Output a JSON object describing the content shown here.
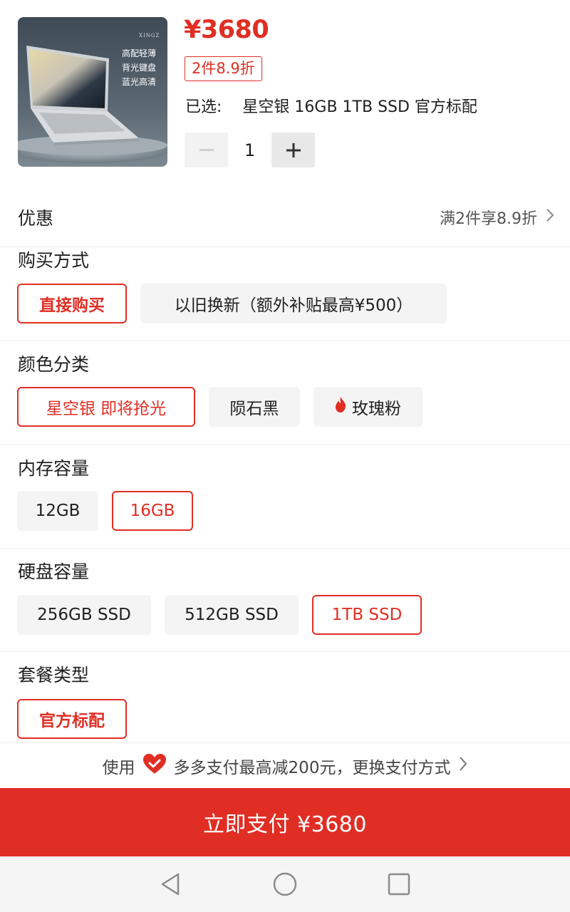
{
  "product": {
    "price": "¥3680",
    "discount_tag": "2件8.9折",
    "selected_label": "已选:",
    "selected_value": "星空银 16GB 1TB SSD 官方标配",
    "quantity": "1",
    "image_text": {
      "brand": "XINGZ",
      "line1": "高配轻薄",
      "line2": "背光键盘",
      "line3": "蓝光高清"
    }
  },
  "promo": {
    "title": "优惠",
    "detail": "满2件享8.9折"
  },
  "purchase": {
    "title": "购买方式",
    "options": [
      "直接购买",
      "以旧换新（额外补贴最高¥500）"
    ]
  },
  "color": {
    "title": "颜色分类",
    "options": [
      "星空银 即将抢光",
      "陨石黑",
      "玫瑰粉"
    ]
  },
  "memory": {
    "title": "内存容量",
    "options": [
      "12GB",
      "16GB"
    ]
  },
  "disk": {
    "title": "硬盘容量",
    "options": [
      "256GB SSD",
      "512GB SSD",
      "1TB SSD"
    ]
  },
  "package": {
    "title": "套餐类型",
    "options": [
      "官方标配"
    ]
  },
  "paytip": {
    "prefix": "使用",
    "text": "多多支付最高减200元，更换支付方式"
  },
  "pay_button": "立即支付 ¥3680",
  "colors": {
    "accent": "#e02e24",
    "option_bg": "#f4f4f4"
  }
}
